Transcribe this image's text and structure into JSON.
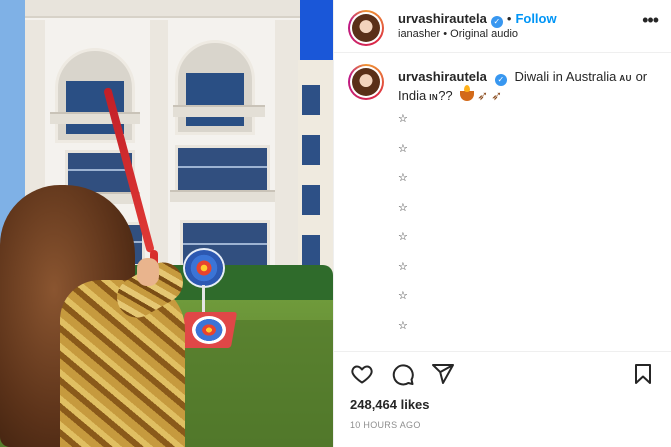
{
  "post": {
    "username": "urvashirautela",
    "verified_icon": "verified-badge-icon",
    "separator": "•",
    "follow_label": "Follow",
    "audio_line": "ianasher • Original audio",
    "more_label": "•••",
    "caption": {
      "username": "urvashirautela",
      "text_part1": "Diwali in Australia",
      "flag_au": "AU",
      "text_part2": "or India",
      "flag_in": "IN",
      "text_part3": "??",
      "emojis": [
        "diya-icon",
        "bow-arrow-icon",
        "bow-arrow-icon"
      ],
      "star_lines": [
        "☆",
        "☆",
        "☆",
        "☆",
        "☆",
        "☆",
        "☆",
        "☆"
      ]
    },
    "likes": "248,464 likes",
    "timestamp": "10 HOURS AGO",
    "icons": {
      "like": "heart-icon",
      "comment": "comment-icon",
      "share": "share-icon",
      "save": "bookmark-icon"
    }
  },
  "colors": {
    "follow_blue": "#0095f6",
    "verified_blue": "#3897f0",
    "text": "#262626",
    "muted": "#8e8e8e"
  }
}
